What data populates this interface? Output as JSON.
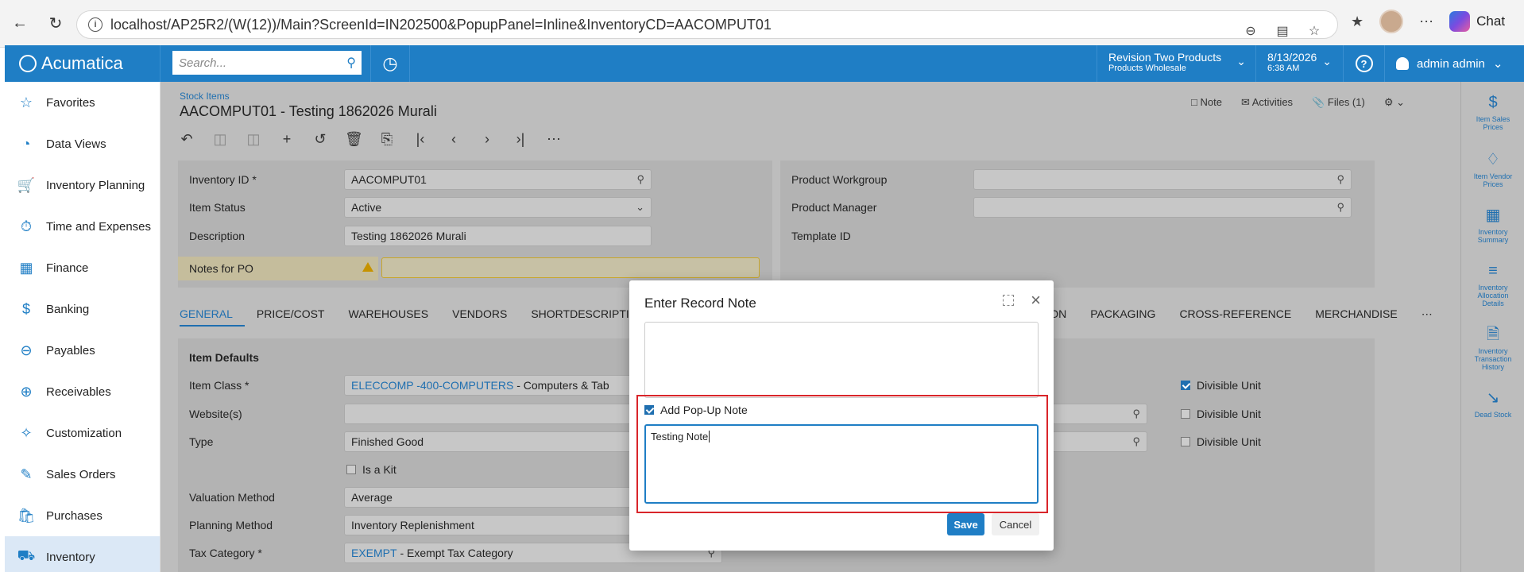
{
  "browser": {
    "url": "localhost/AP25R2/(W(12))/Main?ScreenId=IN202500&PopupPanel=Inline&InventoryCD=AACOMPUT01",
    "chat_label": "Chat"
  },
  "header": {
    "brand": "Acumatica",
    "search_placeholder": "Search...",
    "company_line1": "Revision Two Products",
    "company_line2": "Products Wholesale",
    "date": "8/13/2026",
    "time": "6:38 AM",
    "user": "admin admin"
  },
  "sidebar": {
    "items": [
      {
        "label": "Favorites",
        "icon": "star-icon"
      },
      {
        "label": "Data Views",
        "icon": "pie-chart-icon"
      },
      {
        "label": "Inventory Planning",
        "icon": "cart-icon"
      },
      {
        "label": "Time and Expenses",
        "icon": "stopwatch-icon"
      },
      {
        "label": "Finance",
        "icon": "calculator-icon"
      },
      {
        "label": "Banking",
        "icon": "dollar-icon"
      },
      {
        "label": "Payables",
        "icon": "minus-circle-icon"
      },
      {
        "label": "Receivables",
        "icon": "plus-circle-icon"
      },
      {
        "label": "Customization",
        "icon": "puzzle-icon"
      },
      {
        "label": "Sales Orders",
        "icon": "edit-icon"
      },
      {
        "label": "Purchases",
        "icon": "bag-icon"
      },
      {
        "label": "Inventory",
        "icon": "truck-icon"
      }
    ]
  },
  "page": {
    "breadcrumb": "Stock Items",
    "title": "AACOMPUT01 - Testing 1862026 Murali",
    "note_link": "Note",
    "activities_link": "Activities",
    "files_link": "Files (1)"
  },
  "form": {
    "inventory_id_label": "Inventory ID *",
    "inventory_id_value": "AACOMPUT01",
    "item_status_label": "Item Status",
    "item_status_value": "Active",
    "description_label": "Description",
    "description_value": "Testing 1862026 Murali",
    "notes_po_label": "Notes for PO",
    "product_workgroup_label": "Product Workgroup",
    "product_manager_label": "Product Manager",
    "template_id_label": "Template ID"
  },
  "tabs": [
    "GENERAL",
    "PRICE/COST",
    "WAREHOUSES",
    "VENDORS",
    "SHORTDESCRIPTION",
    "TION",
    "PACKAGING",
    "CROSS-REFERENCE",
    "MERCHANDISE"
  ],
  "general": {
    "section_title": "Item Defaults",
    "item_class_label": "Item Class *",
    "item_class_link": "ELECCOMP -400-COMPUTERS",
    "item_class_rest": " - Computers & Tab",
    "websites_label": "Website(s)",
    "type_label": "Type",
    "type_value": "Finished Good",
    "is_kit_label": "Is a Kit",
    "valuation_label": "Valuation Method",
    "valuation_value": "Average",
    "planning_label": "Planning Method",
    "planning_value": "Inventory Replenishment",
    "tax_label": "Tax Category *",
    "tax_link": "EXEMPT",
    "tax_rest": " - Exempt Tax Category",
    "divisible_unit_label": "Divisible Unit"
  },
  "rightbar": {
    "items": [
      {
        "label1": "Item Sales",
        "label2": "Prices"
      },
      {
        "label1": "Item Vendor",
        "label2": "Prices"
      },
      {
        "label1": "Inventory",
        "label2": "Summary"
      },
      {
        "label1": "Inventory",
        "label2": "Allocation",
        "label3": "Details"
      },
      {
        "label1": "Inventory",
        "label2": "Transaction",
        "label3": "History"
      },
      {
        "label1": "Dead Stock"
      }
    ]
  },
  "dialog": {
    "title": "Enter Record Note",
    "popup_checkbox_label": "Add Pop-Up Note",
    "popup_checked": true,
    "popup_text": "Testing Note",
    "save_label": "Save",
    "cancel_label": "Cancel"
  }
}
